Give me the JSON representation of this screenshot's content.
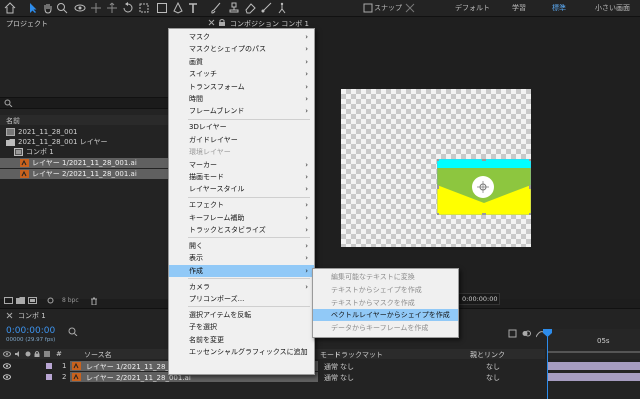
{
  "toolbar": {
    "snap_label": "スナップ",
    "workspaces": [
      "デフォルト",
      "学習",
      "標準",
      "小さい画面"
    ]
  },
  "project_panel": {
    "title": "プロジェクト",
    "column_name": "名前",
    "items": [
      {
        "label": "2021_11_28_001",
        "type": "footage"
      },
      {
        "label": "2021_11_28_001 レイヤー",
        "type": "folder"
      },
      {
        "label": "コンポ 1",
        "type": "composition"
      },
      {
        "label": "レイヤー 1/2021_11_28_001.ai",
        "type": "ai-file"
      },
      {
        "label": "レイヤー 2/2021_11_28_001.ai",
        "type": "ai-file"
      }
    ],
    "bpc": "8 bpc"
  },
  "comp_panel": {
    "tab_label": "コンポジション コンポ 1",
    "timecode": "0:00:00:00"
  },
  "timeline": {
    "tab_label": "コンポ 1",
    "timecode": "0:00:00:00",
    "frame_info": "00000 (29.97 fps)",
    "col_source": "ソース名",
    "col_mode": "モード",
    "col_track": "トラックマット",
    "col_parent": "親とリンク",
    "ruler_label": "05s",
    "layers": [
      {
        "num": "1",
        "name": "レイヤー 1/2021_11_28_001.ai",
        "mode": "通常",
        "track": "なし",
        "parent": "なし"
      },
      {
        "num": "2",
        "name": "レイヤー 2/2021_11_28_001.ai",
        "mode": "通常",
        "track": "なし",
        "parent": "なし"
      }
    ]
  },
  "context_menu": {
    "items": [
      {
        "label": "マスク",
        "submenu": true
      },
      {
        "label": "マスクとシェイプのパス",
        "submenu": true
      },
      {
        "label": "画質",
        "submenu": true
      },
      {
        "label": "スイッチ",
        "submenu": true
      },
      {
        "label": "トランスフォーム",
        "submenu": true
      },
      {
        "label": "時間",
        "submenu": true
      },
      {
        "label": "フレームブレンド",
        "submenu": true
      },
      {
        "label": "3Dレイヤー",
        "submenu": false
      },
      {
        "label": "ガイドレイヤー",
        "submenu": false
      },
      {
        "label": "環境レイヤー",
        "submenu": false,
        "disabled": true
      },
      {
        "label": "マーカー",
        "submenu": true
      },
      {
        "label": "描画モード",
        "submenu": true
      },
      {
        "label": "レイヤースタイル",
        "submenu": true
      },
      {
        "label": "エフェクト",
        "submenu": true
      },
      {
        "label": "キーフレーム補助",
        "submenu": true
      },
      {
        "label": "トラックとスタビライズ",
        "submenu": true
      },
      {
        "label": "開く",
        "submenu": true
      },
      {
        "label": "表示",
        "submenu": true
      },
      {
        "label": "作成",
        "submenu": true,
        "highlighted": true
      },
      {
        "label": "カメラ",
        "submenu": true
      },
      {
        "label": "プリコンポーズ...",
        "submenu": false
      },
      {
        "label": "選択アイテムを反転",
        "submenu": false
      },
      {
        "label": "子を選択",
        "submenu": false
      },
      {
        "label": "名前を変更",
        "submenu": false
      },
      {
        "label": "エッセンシャルグラフィックスに追加",
        "submenu": false
      }
    ]
  },
  "submenu": {
    "items": [
      {
        "label": "編集可能なテキストに変換",
        "disabled": true
      },
      {
        "label": "テキストからシェイプを作成",
        "disabled": true
      },
      {
        "label": "テキストからマスクを作成",
        "disabled": true
      },
      {
        "label": "ベクトルレイヤーからシェイプを作成",
        "highlighted": true
      },
      {
        "label": "データからキーフレームを作成",
        "disabled": true
      }
    ]
  },
  "colors": {
    "menu_highlight": "#91c9f7",
    "cyan": "#00ffff",
    "green": "#8dc63f",
    "yellow": "#ffff00",
    "playhead": "#2d8ceb"
  }
}
